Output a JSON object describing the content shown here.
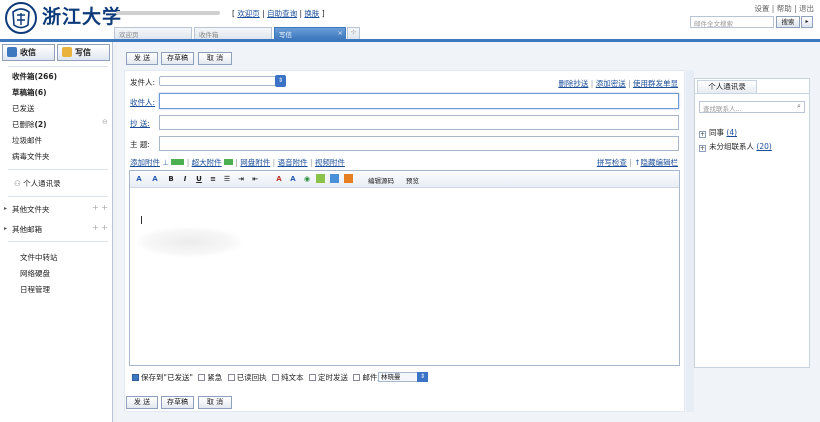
{
  "header": {
    "logo_text": "浙江大学",
    "links": [
      "欢迎页",
      "自助查询",
      "换肤"
    ],
    "right_links": [
      "设置",
      "帮助",
      "退出"
    ],
    "search_placeholder": "邮件全文搜索",
    "search_button": "搜索"
  },
  "tabs": [
    "欢迎页",
    "收件箱",
    "写信"
  ],
  "sidebar": {
    "receive_button": "收信",
    "compose_button": "写信",
    "folders": [
      {
        "label": "收件箱",
        "count": "(266)"
      },
      {
        "label": "草稿箱",
        "count": "(6)"
      },
      {
        "label": "已发送",
        "count": ""
      },
      {
        "label": "已删除",
        "count": "(2)"
      },
      {
        "label": "垃圾邮件",
        "count": ""
      },
      {
        "label": "病毒文件夹",
        "count": ""
      }
    ],
    "contacts_link": "个人通讯录",
    "other_folders": "其他文件夹",
    "other_mailboxes": "其他邮箱",
    "tools": [
      "文件中转站",
      "网络硬盘",
      "日程管理"
    ]
  },
  "toolbar": {
    "send": "发 送",
    "save_draft": "存草稿",
    "cancel": "取 消"
  },
  "compose": {
    "sender_label": "发件人:",
    "to_label": "收件人:",
    "cc_label": "抄 送:",
    "subject_label": "主 题:",
    "right_links": [
      "删除抄送",
      "添加密送",
      "使用群发单显"
    ],
    "attach_links": [
      "添加附件",
      "超大附件",
      "网盘附件",
      "语音附件",
      "视频附件"
    ],
    "editor_links": [
      "拼写检查",
      "隐藏编辑栏"
    ],
    "editor_toolbar_text": [
      "编辑源码",
      "预览"
    ]
  },
  "options": {
    "items": [
      {
        "label": "保存到\"已发送\"",
        "checked": true
      },
      {
        "label": "紧急",
        "checked": false
      },
      {
        "label": "已读回执",
        "checked": false
      },
      {
        "label": "纯文本",
        "checked": false
      },
      {
        "label": "定时发送",
        "checked": false
      },
      {
        "label": "邮件加密",
        "checked": false
      }
    ],
    "signature": "林晓曼"
  },
  "contacts": {
    "tab": "个人通讯录",
    "search_placeholder": "查找联系人...",
    "groups": [
      {
        "label": "同事",
        "count": "(4)"
      },
      {
        "label": "未分组联系人",
        "count": "(20)"
      }
    ]
  },
  "colors": {
    "accent": "#3e78bf",
    "link": "#1b4f9a"
  }
}
